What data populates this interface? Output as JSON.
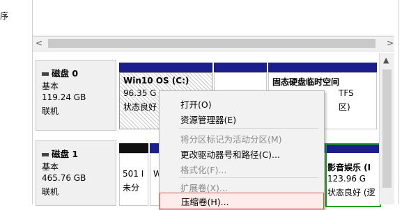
{
  "left_panel": {
    "label": "序"
  },
  "scrollbar": {
    "left_arrow": "<",
    "right_arrow": ">",
    "up_arrow": "▲"
  },
  "disks": [
    {
      "name": "磁盘 0",
      "type": "基本",
      "size": "119.24 GB",
      "status": "联机",
      "partitions": [
        {
          "title": "Win10 OS  (C:)",
          "line2": "96.35 G",
          "line3": "状态良好"
        },
        {
          "title": "",
          "line2": "",
          "line3": ""
        },
        {
          "title": "固态硬盘临时空间",
          "line2": "TFS",
          "line3": "区)"
        }
      ]
    },
    {
      "name": "磁盘 1",
      "type": "基本",
      "size": "465.76 GB",
      "status": "联机",
      "partitions": [
        {
          "title": "",
          "line2": "501 I",
          "line3": "未分"
        },
        {
          "title": "",
          "line2": "W",
          "line3": ""
        },
        {
          "title": "影音娱乐 (I",
          "line2": "123.96 G",
          "line3": "状态良好 (逻"
        }
      ]
    }
  ],
  "context_menu": {
    "items": [
      {
        "label": "打开(O)",
        "enabled": true
      },
      {
        "label": "资源管理器(E)",
        "enabled": true
      },
      {
        "label": "将分区标记为活动分区(M)",
        "enabled": false
      },
      {
        "label": "更改驱动器号和路径(C)...",
        "enabled": true
      },
      {
        "label": "格式化(F)...",
        "enabled": false
      },
      {
        "label": "扩展卷(X)...",
        "enabled": false
      },
      {
        "label": "压缩卷(H)...",
        "enabled": true,
        "highlighted": true
      }
    ]
  },
  "colors": {
    "primary_bar": "#1a1f8c",
    "unallocated_bar": "#111111",
    "logical_border": "#1aa31a",
    "highlight_border": "#d9534f"
  }
}
